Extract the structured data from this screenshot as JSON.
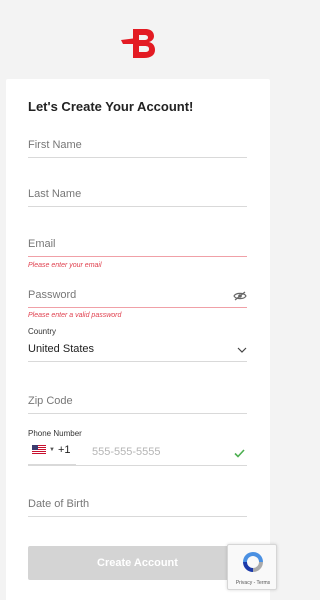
{
  "brand": {
    "logo_letter": "B",
    "accent": "#e31b23"
  },
  "form": {
    "title": "Let's Create Your Account!",
    "first_name": {
      "placeholder": "First Name"
    },
    "last_name": {
      "placeholder": "Last Name"
    },
    "email": {
      "placeholder": "Email",
      "error": "Please enter your email"
    },
    "password": {
      "placeholder": "Password",
      "error": "Please enter a valid password",
      "icon": "eye-off-icon"
    },
    "country": {
      "label": "Country",
      "value": "United States",
      "icon": "chevron-down-icon"
    },
    "zip": {
      "placeholder": "Zip Code"
    },
    "phone": {
      "label": "Phone Number",
      "country_code": "+1",
      "placeholder": "555-555-5555",
      "flag": "us-flag-icon",
      "valid_icon": "check-icon"
    },
    "dob": {
      "placeholder": "Date of Birth"
    },
    "submit_label": "Create Account"
  },
  "recaptcha": {
    "terms": "Privacy - Terms"
  },
  "colors": {
    "error": "#e0414f",
    "success": "#4caf50",
    "button_disabled": "#d4d4d4"
  }
}
